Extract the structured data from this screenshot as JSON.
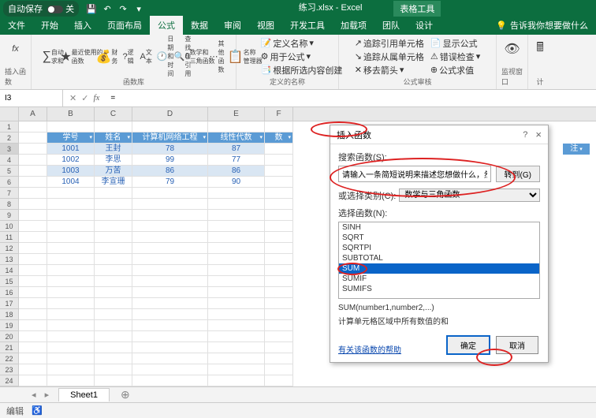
{
  "titlebar": {
    "autosave": "自动保存",
    "off": "关",
    "doc": "练习.xlsx - Excel",
    "tools": "表格工具"
  },
  "qat": {
    "save": "💾",
    "undo": "↶",
    "redo": "↷",
    "more": "▾"
  },
  "tabs": {
    "file": "文件",
    "home": "开始",
    "insert": "插入",
    "layout": "页面布局",
    "formulas": "公式",
    "data": "数据",
    "review": "审阅",
    "view": "视图",
    "dev": "开发工具",
    "addins": "加载项",
    "team": "团队",
    "design": "设计",
    "tell": "告诉我你想要做什么"
  },
  "ribbon": {
    "fx": "fx",
    "insertfn": "插入函数",
    "autosum": "自动求和",
    "recent": "最近使用的\n函数",
    "financial": "财务",
    "logical": "逻辑",
    "text": "文本",
    "datetime": "日期和时间",
    "lookup": "查找与引用",
    "math": "数学和\n三角函数",
    "other": "其他函数",
    "funclib": "函数库",
    "namemgr": "名称\n管理器",
    "defname": "定义名称",
    "usefml": "用于公式",
    "fromsel": "根据所选内容创建",
    "defnames": "定义的名称",
    "trace1": "追踪引用单元格",
    "trace2": "追踪从属单元格",
    "remove": "移去箭头",
    "showfml": "显示公式",
    "errchk": "错误检查",
    "eval": "公式求值",
    "audit": "公式审核",
    "watch": "监视窗口",
    "calc": "计"
  },
  "cellref": "I3",
  "formula": "=",
  "cols": {
    "a": "A",
    "b": "B",
    "c": "C",
    "d": "D",
    "e": "E",
    "f": "F"
  },
  "headers": {
    "id": "学号",
    "name": "姓名",
    "course1": "计算机网络工程",
    "course2": "线性代数",
    "sum": "数",
    "note": "注"
  },
  "data": {
    "r1": {
      "id": "1001",
      "name": "王封",
      "c1": "78",
      "c2": "87"
    },
    "r2": {
      "id": "1002",
      "name": "李思",
      "c1": "99",
      "c2": "77"
    },
    "r3": {
      "id": "1003",
      "name": "万苦",
      "c1": "86",
      "c2": "86"
    },
    "r4": {
      "id": "1004",
      "name": "李宣珊",
      "c1": "79",
      "c2": "90"
    }
  },
  "dialog": {
    "title": "插入函数",
    "help": "?",
    "close": "×",
    "searchlbl": "搜索函数(S):",
    "searchph": "请输入一条简短说明来描述您想做什么，然后单击\"转到\"",
    "goto": "转到(G)",
    "catlbl": "或选择类别(C):",
    "cat": "数学与三角函数",
    "sellbl": "选择函数(N):",
    "fns": {
      "sinh": "SINH",
      "sqrt": "SQRT",
      "sqrtpi": "SQRTPI",
      "subtotal": "SUBTOTAL",
      "sum": "SUM",
      "sumif": "SUMIF",
      "sumifs": "SUMIFS"
    },
    "syntax": "SUM(number1,number2,...)",
    "desc": "计算单元格区域中所有数值的和",
    "helplink": "有关该函数的帮助",
    "ok": "确定",
    "cancel": "取消"
  },
  "sheet": {
    "name": "Sheet1",
    "add": "⊕"
  },
  "status": {
    "mode": "编辑"
  }
}
